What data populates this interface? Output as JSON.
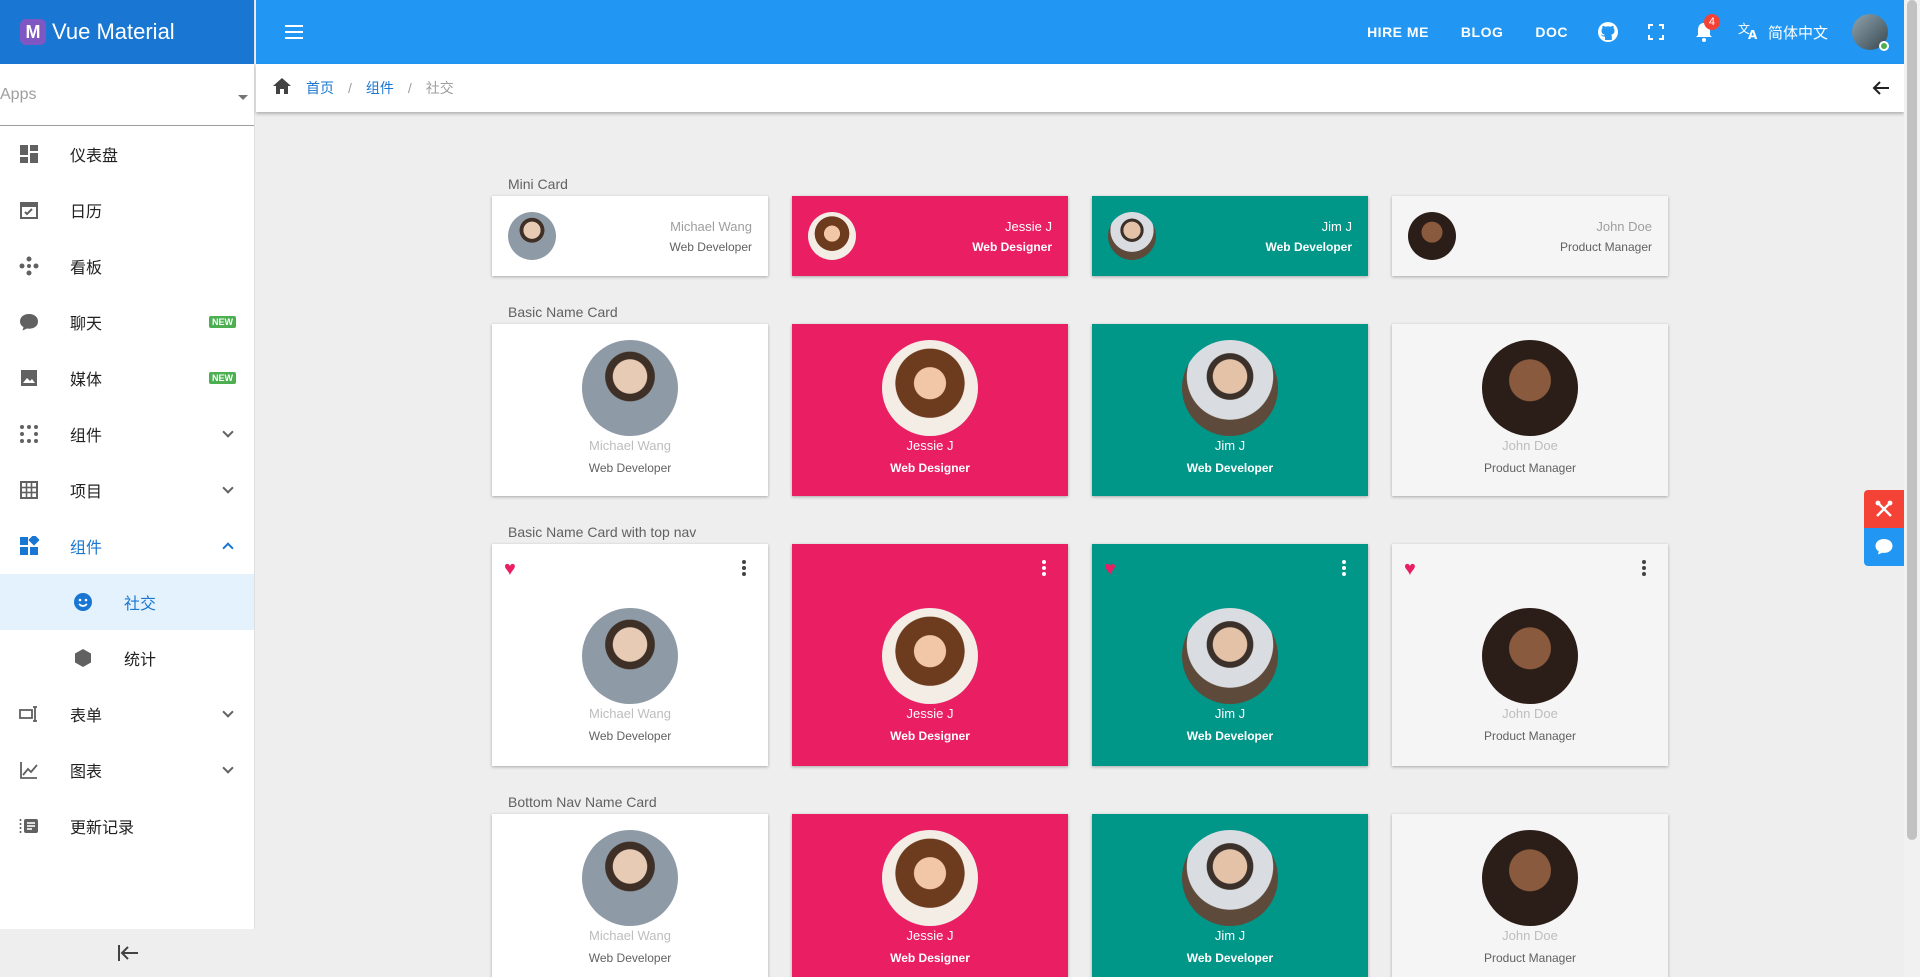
{
  "app": {
    "title": "Vue Material",
    "logo_letter": "M"
  },
  "sidebar": {
    "apps_label": "Apps",
    "items": [
      {
        "label": "仪表盘",
        "icon": "dashboard-icon"
      },
      {
        "label": "日历",
        "icon": "calendar-icon"
      },
      {
        "label": "看板",
        "icon": "kanban-icon"
      },
      {
        "label": "聊天",
        "icon": "chat-icon",
        "badge": "NEW"
      },
      {
        "label": "媒体",
        "icon": "image-icon",
        "badge": "NEW"
      },
      {
        "label": "组件",
        "icon": "apps-grid-icon"
      },
      {
        "label": "项目",
        "icon": "table-icon"
      },
      {
        "label": "组件",
        "icon": "widgets-icon"
      },
      {
        "label": "社交",
        "icon": "social-icon"
      },
      {
        "label": "统计",
        "icon": "hexagon-icon"
      },
      {
        "label": "表单",
        "icon": "form-icon"
      },
      {
        "label": "图表",
        "icon": "chart-line-icon"
      },
      {
        "label": "更新记录",
        "icon": "changelog-icon"
      }
    ]
  },
  "topbar": {
    "hire_me": "HIRE ME",
    "blog": "BLOG",
    "doc": "DOC",
    "notification_count": "4",
    "language": "简体中文"
  },
  "breadcrumb": {
    "home": "首页",
    "parent": "组件",
    "current": "社交"
  },
  "sections": {
    "mini": "Mini Card",
    "basic": "Basic Name Card",
    "topnav": "Basic Name Card with top nav",
    "bottomnav": "Bottom Nav Name Card"
  },
  "people": [
    {
      "name": "Michael Wang",
      "role": "Web Developer",
      "color": "white"
    },
    {
      "name": "Jessie J",
      "role": "Web Designer",
      "color": "pink"
    },
    {
      "name": "Jim J",
      "role": "Web Developer",
      "color": "teal"
    },
    {
      "name": "John Doe",
      "role": "Product Manager",
      "color": "grey"
    }
  ],
  "colors": {
    "primary": "#2196f3",
    "brand": "#1976d2",
    "pink": "#e91e63",
    "teal": "#009688"
  }
}
